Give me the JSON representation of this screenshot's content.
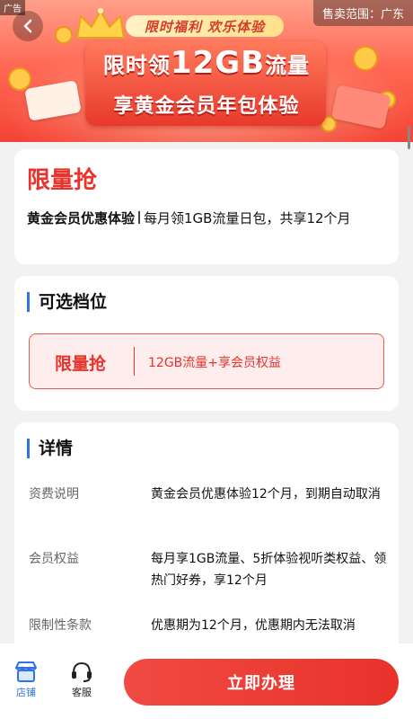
{
  "banner": {
    "ad_tag": "广告",
    "region": "售卖范围：广东",
    "promo": "限时福利 欢乐体验",
    "hero_prefix": "限时领",
    "hero_amount": "12GB",
    "hero_suffix": "流量",
    "hero_line2": "享黄金会员年包体验"
  },
  "package": {
    "title": "限量抢",
    "name": "黄金会员优惠体验",
    "description": "每月领1GB流量日包，共享12个月"
  },
  "options": {
    "section_title": "可选档位",
    "items": [
      {
        "name": "限量抢",
        "desc": "12GB流量+享会员权益"
      }
    ]
  },
  "details": {
    "section_title": "详情",
    "rows": [
      {
        "label": "资费说明",
        "value": "黄金会员优惠体验12个月，到期自动取消"
      },
      {
        "label": "会员权益",
        "value": "每月享1GB流量、5折体验视听类权益、领热门好券，享12个月"
      },
      {
        "label": "限制性条款",
        "value": "优惠期为12个月，优惠期内无法取消"
      }
    ]
  },
  "bottom_bar": {
    "store_label": "店铺",
    "service_label": "客服",
    "cta_label": "立即办理"
  },
  "colors": {
    "accent_red": "#e8322b",
    "accent_blue": "#2f73e8"
  }
}
